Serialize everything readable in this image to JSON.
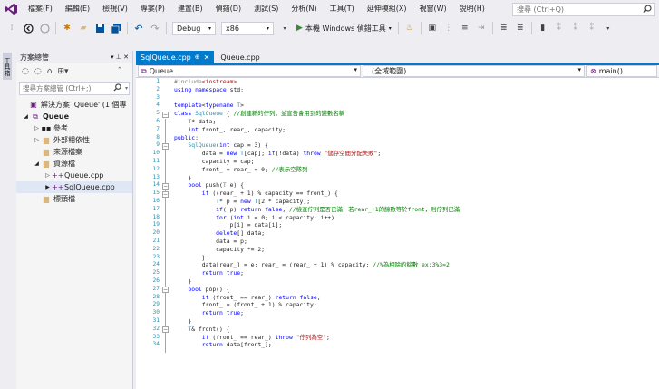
{
  "menubar": {
    "items": [
      "檔案(F)",
      "編輯(E)",
      "檢視(V)",
      "專案(P)",
      "建置(B)",
      "偵錯(D)",
      "測試(S)",
      "分析(N)",
      "工具(T)",
      "延伸模組(X)",
      "視窗(W)",
      "說明(H)"
    ],
    "search_placeholder": "搜尋 (Ctrl+Q)"
  },
  "toolbar": {
    "config": "Debug",
    "platform": "x86",
    "run_label": "本機 Windows 偵錯工具"
  },
  "side_strip": {
    "label": "工具箱"
  },
  "solution_explorer": {
    "title": "方案總管",
    "pin": "▾ ⊥ ✕",
    "search_placeholder": "搜尋方案總管 (Ctrl+;)",
    "tree": [
      {
        "label": "解決方案 'Queue' (1 個專",
        "icon": "solution-icon"
      },
      {
        "label": "Queue",
        "icon": "project-icon"
      },
      {
        "label": "參考",
        "icon": "references-icon"
      },
      {
        "label": "外部相依性",
        "icon": "folder-icon"
      },
      {
        "label": "來源檔案",
        "icon": "folder-icon"
      },
      {
        "label": "資源檔",
        "icon": "folder-icon"
      },
      {
        "label": "Queue.cpp",
        "icon": "cpp-file-icon"
      },
      {
        "label": "SqlQueue.cpp",
        "icon": "cpp-file-icon"
      },
      {
        "label": "標頭檔",
        "icon": "folder-icon"
      }
    ]
  },
  "tabs": [
    {
      "label": "SqlQueue.cpp",
      "pin": "⊕",
      "close": "✕",
      "active": true
    },
    {
      "label": "Queue.cpp",
      "active": false
    }
  ],
  "navbar": {
    "project": "Queue",
    "scope": "(全域範圍)",
    "member": "main()"
  },
  "editor": {
    "line_numbers": [
      "1",
      "2",
      "3",
      "4",
      "5",
      "6",
      "7",
      "8",
      "9",
      "10",
      "11",
      "12",
      "13",
      "14",
      "15",
      "16",
      "17",
      "18",
      "19",
      "20",
      "21",
      "22",
      "23",
      "24",
      "25",
      "26",
      "27",
      "28",
      "29",
      "30",
      "31",
      "32",
      "33",
      "34"
    ],
    "lines": [
      "#include<iostream>",
      "using namespace std;",
      "",
      "template<typename T>",
      "class SqlQueue { //創建新的佇列，並宣告會用到的變數名稱",
      "    T* data;",
      "    int front_, rear_, capacity;",
      "public:",
      "    SqlQueue(int cap = 3) {",
      "        data = new T[cap]; if(!data) throw \"儲存空間分配失敗\";",
      "        capacity = cap;",
      "        front_ = rear_ = 0; //表示空隊列",
      "    }",
      "    bool push(T e) {",
      "        if ((rear_ + 1) % capacity == front_) {",
      "            T* p = new T[2 * capacity];",
      "            if(!p) return false; //檢查佇列是否已滿，若rear_+1的餘數等於front，則佇列已滿",
      "            for (int i = 0; i < capacity; i++)",
      "                p[i] = data[i];",
      "            delete[] data;",
      "            data = p;",
      "            capacity *= 2;",
      "        }",
      "        data[rear_] = e; rear_ = (rear_ + 1) % capacity; //%為相除的餘數 ex:3%3=2",
      "        return true;",
      "    }",
      "    bool pop() {",
      "        if (front_ == rear_) return false;",
      "        front_ = (front_ + 1) % capacity;",
      "        return true;",
      "    }",
      "    T& front() {",
      "        if (front_ == rear_) throw \"佇列為空\";",
      "        return data[front_];"
    ]
  },
  "colors": {
    "accent": "#007acc",
    "keyword": "#0000ff",
    "string": "#a31515",
    "comment": "#008000",
    "type": "#2b91af"
  }
}
